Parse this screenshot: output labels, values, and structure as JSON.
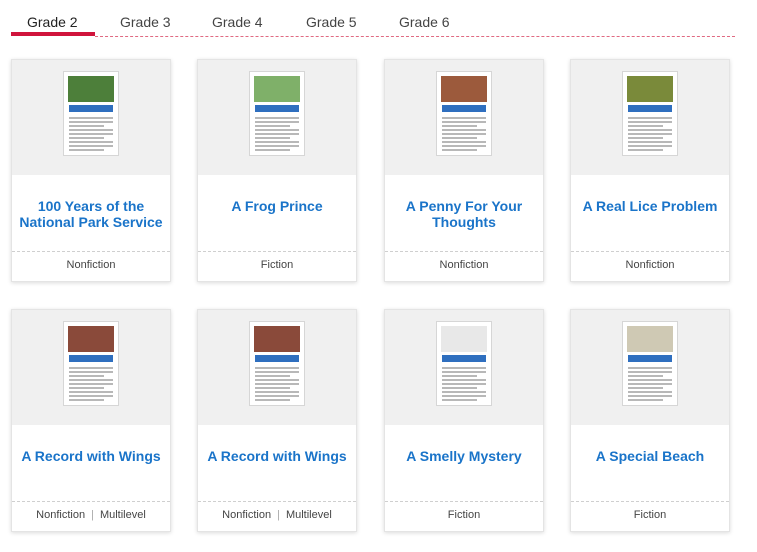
{
  "tabs": [
    {
      "label": "Grade 2",
      "active": true
    },
    {
      "label": "Grade 3",
      "active": false
    },
    {
      "label": "Grade 4",
      "active": false
    },
    {
      "label": "Grade 5",
      "active": false
    },
    {
      "label": "Grade 6",
      "active": false
    }
  ],
  "colors": {
    "accent": "#d0143c",
    "title_blue": "#1a74c9",
    "thumb_bg": "#f0f0f0"
  },
  "cards": [
    {
      "title": "100 Years of the National Park Service",
      "genre": "Nonfiction",
      "level": "",
      "thumb_color": "#4d7f3a"
    },
    {
      "title": "A Frog Prince",
      "genre": "Fiction",
      "level": "",
      "thumb_color": "#7fb069"
    },
    {
      "title": "A Penny For Your Thoughts",
      "genre": "Nonfiction",
      "level": "",
      "thumb_color": "#9c5a3c"
    },
    {
      "title": "A Real Lice Problem",
      "genre": "Nonfiction",
      "level": "",
      "thumb_color": "#7a8a3a"
    },
    {
      "title": "A Record with Wings",
      "genre": "Nonfiction",
      "level": "Multilevel",
      "thumb_color": "#8a4a3a"
    },
    {
      "title": "A Record with Wings",
      "genre": "Nonfiction",
      "level": "Multilevel",
      "thumb_color": "#8a4a3a"
    },
    {
      "title": "A Smelly Mystery",
      "genre": "Fiction",
      "level": "",
      "thumb_color": "#e8e8e8"
    },
    {
      "title": "A Special Beach",
      "genre": "Fiction",
      "level": "",
      "thumb_color": "#cfc9b4"
    }
  ]
}
